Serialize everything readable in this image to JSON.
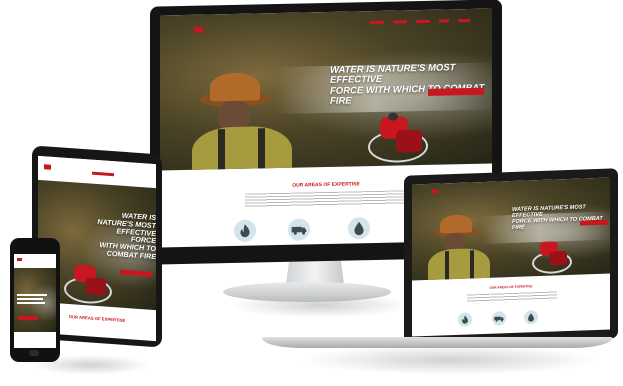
{
  "headline": {
    "desktop_line1": "WATER IS NATURE'S MOST EFFECTIVE",
    "desktop_line2": "FORCE WITH WHICH TO COMBAT FIRE",
    "laptop_line1": "WATER IS NATURE'S MOST EFFECTIVE",
    "laptop_line2": "FORCE WITH WHICH TO COMBAT FIRE",
    "tablet_lines": [
      "WATER IS",
      "NATURE'S MOST",
      "EFFECTIVE FORCE",
      "WITH WHICH TO",
      "COMBAT FIRE"
    ]
  },
  "section": {
    "expertise_title": "OUR AREAS OF EXPERTISE"
  },
  "icons": {
    "fire": "flame-icon",
    "truck": "fire-truck-icon",
    "water": "water-drop-icon"
  },
  "colors": {
    "brand_red": "#c8171e",
    "icon_circle": "#d3e4ea",
    "bezel": "#141414"
  }
}
